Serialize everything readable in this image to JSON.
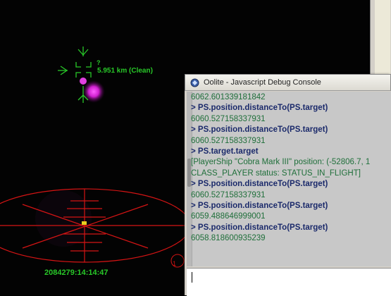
{
  "game": {
    "target_info": "5.951 km (Clean)",
    "target_marker": "?",
    "clock": "2084279:14:14:47",
    "compass_edge": "1",
    "colors": {
      "hud_green": "#28c828",
      "scanner_red": "#d41414",
      "planet_magenta": "#e020e0"
    }
  },
  "console": {
    "title": "Oolite - Javascript Debug Console",
    "lines": [
      {
        "kind": "res",
        "text": "6062.601339181842"
      },
      {
        "kind": "cmd",
        "text": "> PS.position.distanceTo(PS.target)"
      },
      {
        "kind": "res",
        "text": "6060.527158337931"
      },
      {
        "kind": "cmd",
        "text": "> PS.position.distanceTo(PS.target)"
      },
      {
        "kind": "res",
        "text": "6060.527158337931"
      },
      {
        "kind": "cmd",
        "text": "> PS.target.target"
      },
      {
        "kind": "res",
        "text": "[PlayerShip \"Cobra Mark III\" position: (-52806.7, 1"
      },
      {
        "kind": "res",
        "text": "CLASS_PLAYER status: STATUS_IN_FLIGHT]"
      },
      {
        "kind": "cmd",
        "text": "> PS.position.distanceTo(PS.target)"
      },
      {
        "kind": "res",
        "text": "6060.527158337931"
      },
      {
        "kind": "cmd",
        "text": "> PS.position.distanceTo(PS.target)"
      },
      {
        "kind": "res",
        "text": "6059.488646999001"
      },
      {
        "kind": "cmd",
        "text": "> PS.position.distanceTo(PS.target)"
      },
      {
        "kind": "res",
        "text": "6058.818600935239"
      }
    ],
    "input_value": ""
  }
}
